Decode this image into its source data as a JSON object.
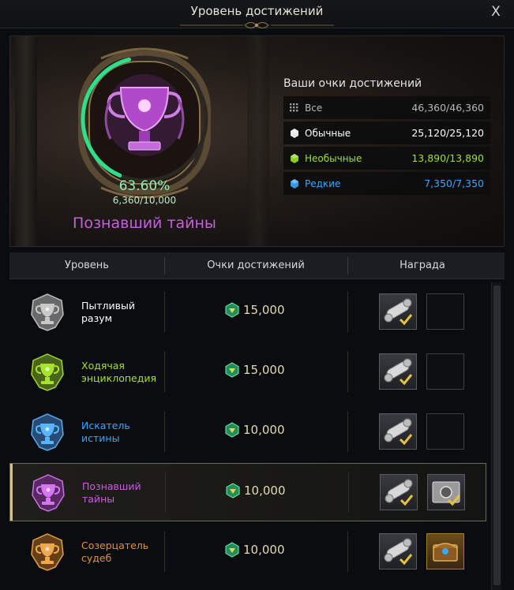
{
  "window": {
    "title": "Уровень достижений",
    "close_label": "X"
  },
  "current": {
    "progress_percent_text": "63.60%",
    "progress_fraction": 0.636,
    "points_text": "6,360/10,000",
    "rank_name": "Познавший тайны"
  },
  "stats": {
    "heading": "Ваши очки достижений",
    "rows": [
      {
        "label": "Все",
        "value": "46,360/46,360",
        "icon": "grid-icon",
        "color": "#9a9a9a"
      },
      {
        "label": "Обычные",
        "value": "25,120/25,120",
        "icon": "white-gem-icon",
        "color": "#ffffff"
      },
      {
        "label": "Необычные",
        "value": "13,890/13,890",
        "icon": "green-gem-icon",
        "color": "#9be22b"
      },
      {
        "label": "Редкие",
        "value": "7,350/7,350",
        "icon": "blue-gem-icon",
        "color": "#3aa7ff"
      }
    ]
  },
  "table": {
    "headers": {
      "level": "Уровень",
      "points": "Очки достижений",
      "reward": "Награда"
    },
    "rows": [
      {
        "name": "Пытливый разум",
        "points": "15,000",
        "color": "#ffffff",
        "emblem": "silver-trophy-emblem-icon",
        "rewards": [
          "scroll-reward-icon",
          "empty-slot"
        ],
        "active": false
      },
      {
        "name": "Ходячая энциклопедия",
        "points": "15,000",
        "color": "#a6e22e",
        "emblem": "green-trophy-emblem-icon",
        "rewards": [
          "scroll-reward-icon",
          "empty-slot"
        ],
        "active": false
      },
      {
        "name": "Искатель истины",
        "points": "10,000",
        "color": "#3aa7ff",
        "emblem": "blue-trophy-emblem-icon",
        "rewards": [
          "scroll-reward-icon",
          "empty-slot"
        ],
        "active": false
      },
      {
        "name": "Познавший тайны",
        "points": "10,000",
        "color": "#c85ee0",
        "emblem": "purple-trophy-emblem-icon",
        "rewards": [
          "scroll-reward-icon",
          "safe-reward-icon"
        ],
        "active": true
      },
      {
        "name": "Созерцатель судеб",
        "points": "10,000",
        "color": "#e8902a",
        "emblem": "gold-trophy-emblem-icon",
        "rewards": [
          "scroll-reward-icon",
          "chest-reward-icon"
        ],
        "active": false
      }
    ]
  },
  "colors": {
    "accent_green": "#2fe08a",
    "reward_check": "#e8c23a"
  }
}
